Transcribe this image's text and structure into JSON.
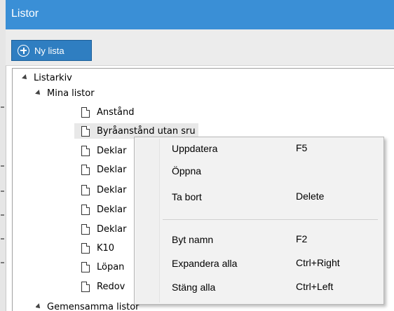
{
  "window": {
    "title": "Listor"
  },
  "toolbar": {
    "new_list_label": "Ny lista"
  },
  "tree": {
    "root": "Listarkiv",
    "group1": "Mina listor",
    "items": [
      "Anstånd",
      "Byråanstånd utan sru",
      "Deklar",
      "Deklar",
      "Deklar",
      "Deklar",
      "Deklar",
      "K10",
      "Löpan",
      "Redov"
    ],
    "group2": "Gemensamma listor"
  },
  "context_menu": {
    "items": [
      {
        "label": "Uppdatera",
        "shortcut": "F5"
      },
      {
        "label": "Öppna",
        "shortcut": ""
      },
      {
        "label": "Ta bort",
        "shortcut": "Delete"
      },
      {
        "label": "Byt namn",
        "shortcut": "F2"
      },
      {
        "label": "Expandera alla",
        "shortcut": "Ctrl+Right"
      },
      {
        "label": "Stäng alla",
        "shortcut": "Ctrl+Left"
      }
    ]
  },
  "colors": {
    "titlebar": "#3a8fd6",
    "button": "#2f7ec1",
    "menu_bg": "#f2f2f2"
  }
}
